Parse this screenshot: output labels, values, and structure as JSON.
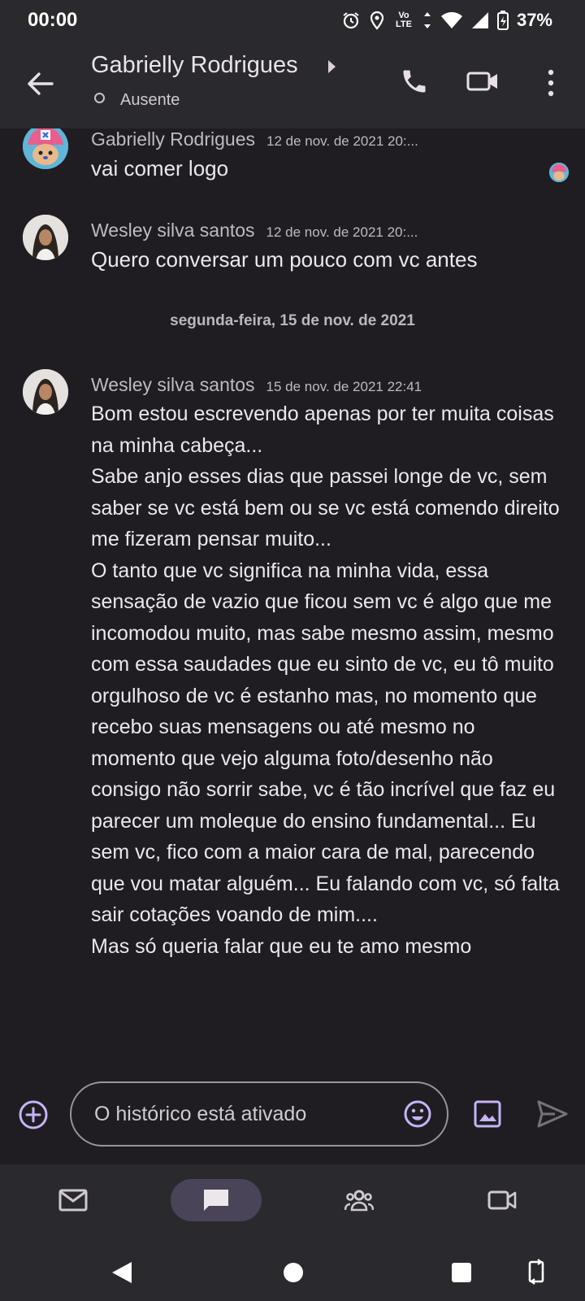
{
  "status_bar": {
    "time": "00:00",
    "network": "Vo LTE",
    "battery": "37%"
  },
  "header": {
    "title": "Gabrielly Rodrigues",
    "status": "Ausente"
  },
  "messages": [
    {
      "sender": "Gabrielly Rodrigues",
      "timestamp": "12 de nov. de 2021 20:...",
      "text": "vai comer logo"
    },
    {
      "sender": "Wesley silva santos",
      "timestamp": "12 de nov. de 2021 20:...",
      "text": "Quero conversar um pouco com vc antes"
    },
    {
      "date_separator": "segunda-feira, 15 de nov. de 2021"
    },
    {
      "sender": "Wesley silva santos",
      "timestamp": "15 de nov. de 2021 22:41",
      "text": "Bom estou escrevendo apenas por ter muita coisas na minha cabeça...\nSabe anjo esses dias que passei longe de vc, sem saber se vc está bem ou se vc está comendo direito me fizeram pensar muito...\nO tanto que vc significa na minha vida, essa sensação de vazio que ficou sem vc é algo que me incomodou muito, mas sabe mesmo assim, mesmo com essa saudades que eu sinto de vc, eu tô muito orgulhoso de vc é estanho mas, no momento que recebo suas mensagens ou até mesmo no momento que vejo alguma foto/desenho não consigo não sorrir sabe, vc é tão incrível que faz eu parecer um moleque do ensino fundamental... Eu sem vc, fico com a maior cara de mal, parecendo que vou matar alguém... Eu falando com vc, só falta sair cotações voando de mim....\nMas só queria falar que eu te amo mesmo"
    }
  ],
  "composer": {
    "placeholder": "O histórico está ativado"
  },
  "icons": {
    "back": "arrow-back-icon",
    "call": "phone-icon",
    "video": "video-call-icon",
    "more": "more-vert-icon",
    "add": "add-circle-icon",
    "emoji": "emoji-icon",
    "image": "image-icon",
    "send": "send-icon",
    "nav": [
      "mail-icon",
      "chat-icon",
      "people-icon",
      "video-icon"
    ]
  },
  "colors": {
    "accent": "#c6b4f5",
    "nav_active": "#4a4458"
  }
}
